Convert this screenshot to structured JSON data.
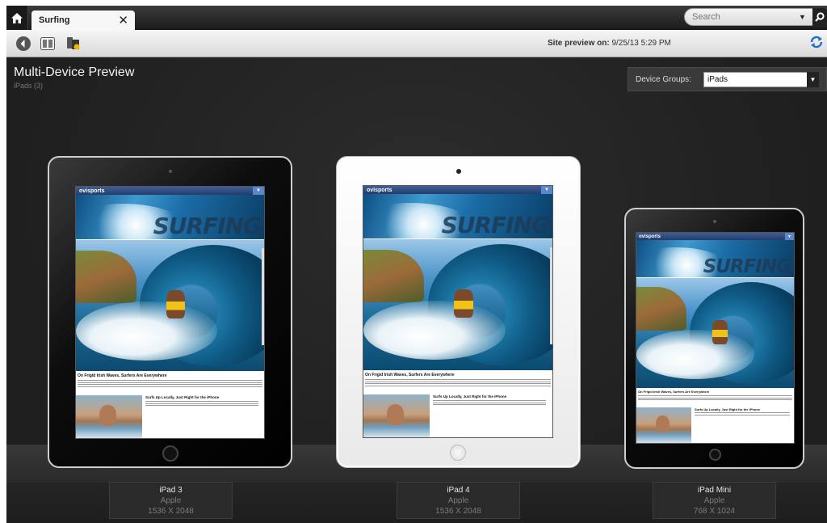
{
  "tabbar": {
    "tab_label": "Surfing",
    "close_glyph": "✕",
    "search_placeholder": "Search"
  },
  "toolbar": {
    "site_preview_label": "Site preview on:",
    "site_preview_value": "9/25/13 5:29 PM"
  },
  "main": {
    "title": "Multi-Device Preview",
    "subtitle": "iPads (3)",
    "device_groups_label": "Device Groups:",
    "device_groups_value": "iPads"
  },
  "site": {
    "brand": "ovisports",
    "banner_text": "SURFING",
    "headline": "On Frigid Irish Waves, Surfers Are Everywhere",
    "side_headline": "Surfs Up Locally, Just Right for the iPhone"
  },
  "devices": [
    {
      "name": "iPad 3",
      "maker": "Apple",
      "resolution": "1536 X 2048",
      "color": "black"
    },
    {
      "name": "iPad 4",
      "maker": "Apple",
      "resolution": "1536 X 2048",
      "color": "white"
    },
    {
      "name": "iPad Mini",
      "maker": "Apple",
      "resolution": "768 X 1024",
      "color": "black"
    }
  ],
  "colors": {
    "background": "#222222",
    "caption_bg": "#2a2a2a",
    "site_header": "#2f4b80",
    "refresh_icon": "#1a6fd0"
  }
}
